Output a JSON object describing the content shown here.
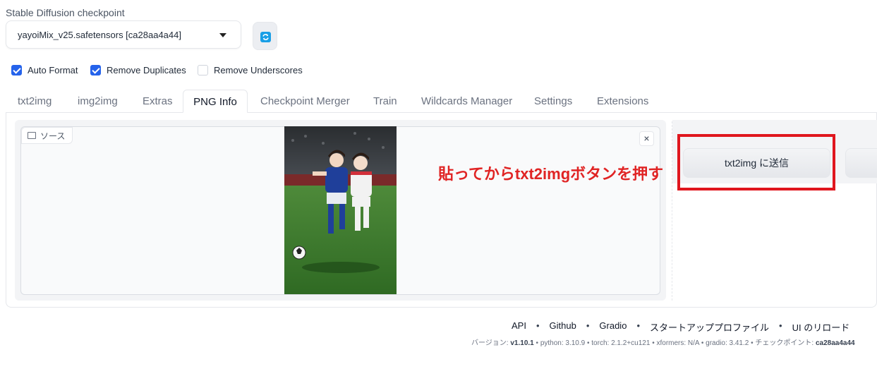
{
  "checkpoint": {
    "label": "Stable Diffusion checkpoint",
    "value": "yayoiMix_v25.safetensors [ca28aa4a44]"
  },
  "options": [
    {
      "label": "Auto Format",
      "checked": true
    },
    {
      "label": "Remove Duplicates",
      "checked": true
    },
    {
      "label": "Remove Underscores",
      "checked": false
    }
  ],
  "tabs": [
    "txt2img",
    "img2img",
    "Extras",
    "PNG Info",
    "Checkpoint Merger",
    "Train",
    "Wildcards Manager",
    "Settings",
    "Extensions"
  ],
  "active_tab": "PNG Info",
  "source_label": "ソース",
  "close_glyph": "×",
  "annotation": "貼ってからtxt2imgボタンを押す",
  "send_button": "txt2img に送信",
  "footer": {
    "links": [
      "API",
      "Github",
      "Gradio",
      "スタートアッププロファイル",
      "UI のリロード"
    ],
    "separator": "•",
    "version_label": "バージョン: ",
    "version": "v1.10.1",
    "python": "python: 3.10.9",
    "torch": "torch: 2.1.2+cu121",
    "xformers": "xformers: N/A",
    "gradio": "gradio: 3.41.2",
    "checkpoint_label": "チェックポイント: ",
    "checkpoint": "ca28aa4a44"
  },
  "colors": {
    "accent": "#2563eb",
    "annotation_red": "#e02424",
    "highlight_border": "#e0161e",
    "refresh_icon": "#1a9fe6"
  },
  "icons": [
    "refresh-icon",
    "dropdown-caret-icon",
    "image-icon",
    "close-icon",
    "checkmark-icon"
  ]
}
